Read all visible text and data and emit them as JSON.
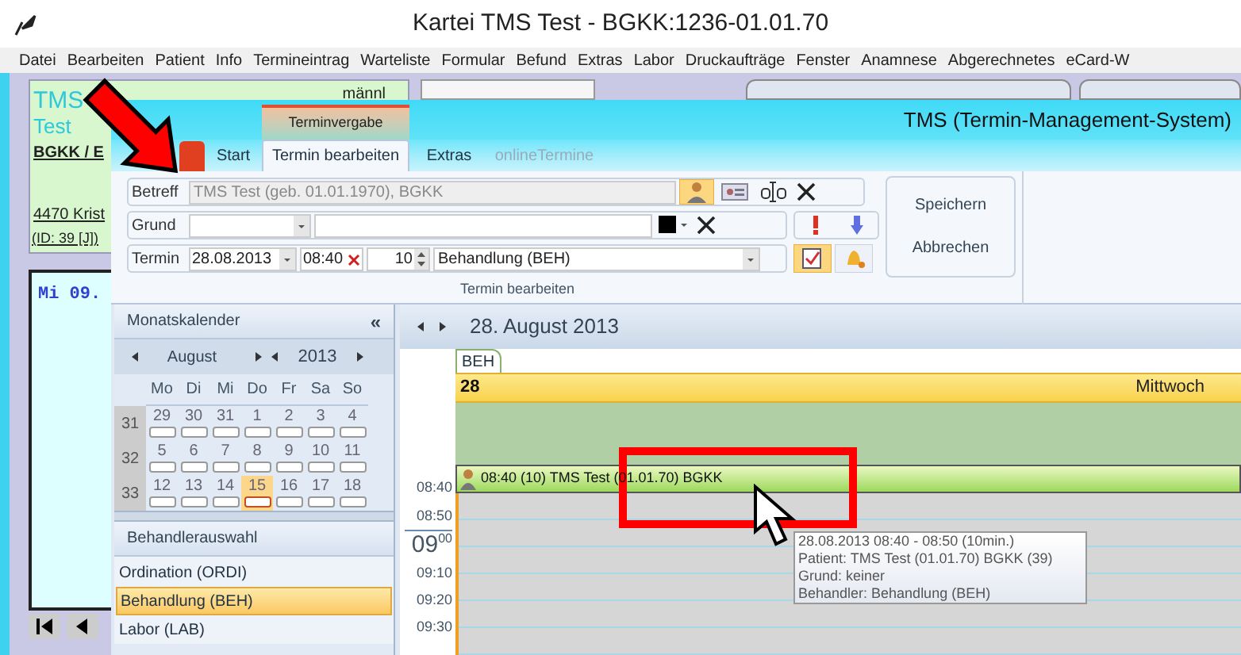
{
  "window": {
    "title": "Kartei TMS Test - BGKK:1236-01.01.70"
  },
  "menu": [
    "Datei",
    "Bearbeiten",
    "Patient",
    "Info",
    "Termineintrag",
    "Warteliste",
    "Formular",
    "Befund",
    "Extras",
    "Labor",
    "Druckaufträge",
    "Fenster",
    "Anamnese",
    "Abgerechnetes",
    "eCard-W"
  ],
  "patient_card": {
    "name": "TMS",
    "gender": "männl",
    "first_name": "Test",
    "insurance": "BGKK / E",
    "address": "4470 Krist",
    "id": "(ID: 39 [J])"
  },
  "day_panel": {
    "label": "Mi 09."
  },
  "tms": {
    "title": "TMS (Termin-Management-System)",
    "context_group": "Terminvergabe",
    "tabs": [
      {
        "label": "Start",
        "selected": false,
        "disabled": false
      },
      {
        "label": "Termin bearbeiten",
        "selected": true,
        "disabled": false
      },
      {
        "label": "Extras",
        "selected": false,
        "disabled": false
      },
      {
        "label": "onlineTermine",
        "selected": false,
        "disabled": true
      }
    ],
    "betreff": {
      "label": "Betreff",
      "value": "TMS Test (geb. 01.01.1970), BGKK"
    },
    "grund": {
      "label": "Grund"
    },
    "termin": {
      "label": "Termin",
      "date": "28.08.2013",
      "time": "08:40",
      "duration": "10",
      "behandler": "Behandlung (BEH)"
    },
    "group_label": "Termin bearbeiten",
    "actions": [
      "Speichern",
      "Abbrechen"
    ]
  },
  "calendar": {
    "title": "Monatskalender",
    "collapse": "«",
    "month": "August",
    "year": "2013",
    "weekdays": [
      "Mo",
      "Di",
      "Mi",
      "Do",
      "Fr",
      "Sa",
      "So"
    ],
    "weeks": [
      {
        "number": "31",
        "days": [
          {
            "day": "29",
            "today": false
          },
          {
            "day": "30",
            "today": false
          },
          {
            "day": "31",
            "today": false
          },
          {
            "day": "1",
            "today": false
          },
          {
            "day": "2",
            "today": false
          },
          {
            "day": "3",
            "today": false
          },
          {
            "day": "4",
            "today": false
          }
        ]
      },
      {
        "number": "32",
        "days": [
          {
            "day": "5",
            "today": false
          },
          {
            "day": "6",
            "today": false
          },
          {
            "day": "7",
            "today": false
          },
          {
            "day": "8",
            "today": false
          },
          {
            "day": "9",
            "today": false
          },
          {
            "day": "10",
            "today": false
          },
          {
            "day": "11",
            "today": false
          }
        ]
      },
      {
        "number": "33",
        "days": [
          {
            "day": "12",
            "today": false
          },
          {
            "day": "13",
            "today": false
          },
          {
            "day": "14",
            "today": false
          },
          {
            "day": "15",
            "today": true
          },
          {
            "day": "16",
            "today": false
          },
          {
            "day": "17",
            "today": false
          },
          {
            "day": "18",
            "today": false
          }
        ]
      }
    ]
  },
  "behandler": {
    "title": "Behandlerauswahl",
    "items": [
      {
        "label": "Ordination (ORDI)",
        "selected": false
      },
      {
        "label": "Behandlung (BEH)",
        "selected": true
      },
      {
        "label": "Labor (LAB)",
        "selected": false
      }
    ]
  },
  "day_view": {
    "date": "28. August 2013",
    "resource": "BEH",
    "day_number": "28",
    "weekday": "Mittwoch",
    "times": [
      {
        "kind": "full",
        "text": "08:50"
      },
      {
        "kind": "hour",
        "hour": "09",
        "minutes": "00"
      },
      {
        "kind": "full",
        "text": "09:10"
      },
      {
        "kind": "full",
        "text": "09:20"
      },
      {
        "kind": "full",
        "text": "09:30"
      }
    ],
    "appointment": {
      "time": "08:40",
      "text": "08:40 (10) TMS Test (01.01.70) BGKK"
    },
    "tooltip": [
      "28.08.2013 08:40 - 08:50 (10min.)",
      "Patient: TMS Test (01.01.70) BGKK (39)",
      "Grund: keiner",
      "Behandler: Behandlung (BEH)"
    ]
  }
}
